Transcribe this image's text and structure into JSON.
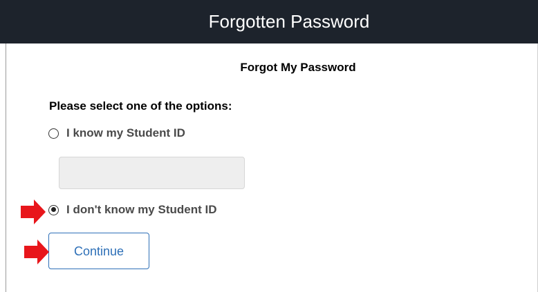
{
  "header": {
    "title": "Forgotten Password"
  },
  "form": {
    "subheading": "Forgot My Password",
    "instruction": "Please select one of the options:",
    "options": [
      {
        "label": "I know my Student ID",
        "selected": false
      },
      {
        "label": "I don't know my Student ID",
        "selected": true
      }
    ],
    "student_id_value": "",
    "continue_label": "Continue"
  },
  "annotations": {
    "arrow_color": "#e8161b",
    "arrow_icon": "right-arrow-icon"
  },
  "colors": {
    "header_bg": "#1d232c",
    "header_text": "#ffffff",
    "button_accent": "#2d6fb7"
  }
}
